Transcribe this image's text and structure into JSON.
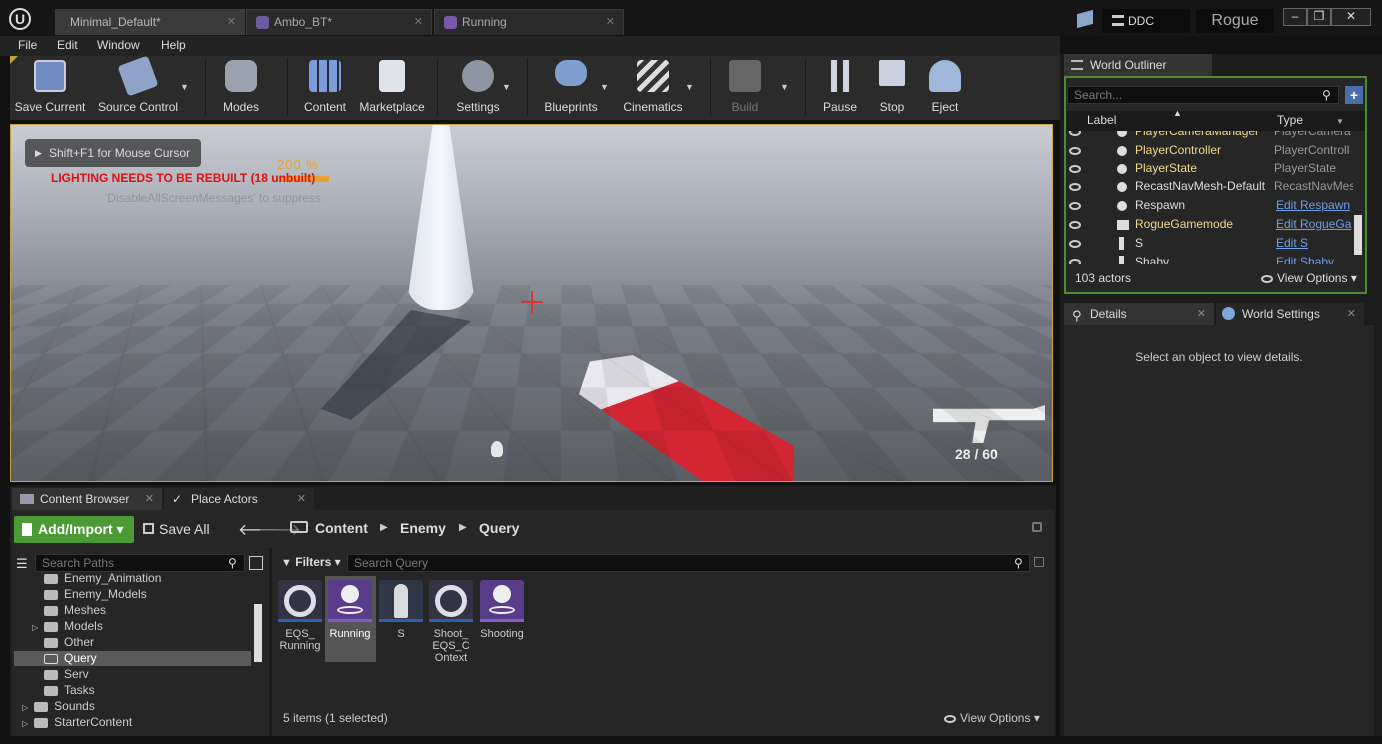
{
  "window": {
    "tabs": [
      {
        "label": "Minimal_Default*"
      },
      {
        "label": "Ambo_BT*"
      },
      {
        "label": "Running"
      }
    ],
    "ddc": "DDC",
    "project": "Rogue"
  },
  "menu": {
    "file": "File",
    "edit": "Edit",
    "window": "Window",
    "help": "Help"
  },
  "toolbar": {
    "save_current": "Save Current",
    "source_control": "Source Control",
    "modes": "Modes",
    "content": "Content",
    "marketplace": "Marketplace",
    "settings": "Settings",
    "blueprints": "Blueprints",
    "cinematics": "Cinematics",
    "build": "Build",
    "pause": "Pause",
    "stop": "Stop",
    "eject": "Eject"
  },
  "viewport": {
    "cursor_hint": "Shift+F1 for Mouse Cursor",
    "zoom": "200 %",
    "lighting_warning": "LIGHTING NEEDS TO BE REBUILT (18 unbuilt)",
    "suppress_hint": "'DisableAllScreenMessages' to suppress",
    "ammo": "28 / 60"
  },
  "outliner": {
    "title": "World Outliner",
    "search_placeholder": "Search...",
    "col_label": "Label",
    "col_type": "Type",
    "rows": [
      {
        "label": "PlayerCameraManager",
        "type": "PlayerCamera",
        "link": false
      },
      {
        "label": "PlayerController",
        "type": "PlayerControll",
        "link": false
      },
      {
        "label": "PlayerState",
        "type": "PlayerState",
        "link": false
      },
      {
        "label": "RecastNavMesh-Default",
        "type": "RecastNavMes",
        "link": false
      },
      {
        "label": "Respawn",
        "type": "Edit Respawn",
        "link": true
      },
      {
        "label": "RogueGamemode",
        "type": "Edit RogueGa",
        "link": true
      },
      {
        "label": "S",
        "type": "Edit S",
        "link": true
      },
      {
        "label": "Shaby",
        "type": "Edit Shaby",
        "link": true
      }
    ],
    "count": "103 actors",
    "view_options": "View Options"
  },
  "details": {
    "tab": "Details",
    "world_settings": "World Settings",
    "empty": "Select an object to view details."
  },
  "content_browser": {
    "tab": "Content Browser",
    "place_actors": "Place Actors",
    "add_import": "Add/Import",
    "save_all": "Save All",
    "breadcrumb": [
      "Content",
      "Enemy",
      "Query"
    ],
    "search_paths": "Search Paths",
    "filters": "Filters",
    "search_query": "Search Query",
    "tree": [
      "Enemy_Animation",
      "Enemy_Models",
      "Meshes",
      "Models",
      "Other",
      "Query",
      "Serv",
      "Tasks",
      "Sounds",
      "StarterContent"
    ],
    "assets": [
      {
        "name": "EQS_\nRunning"
      },
      {
        "name": "Running"
      },
      {
        "name": "S"
      },
      {
        "name": "Shoot_\nEQS_C\nOntext"
      },
      {
        "name": "Shooting"
      }
    ],
    "status": "5 items (1 selected)",
    "view_options": "View Options"
  }
}
